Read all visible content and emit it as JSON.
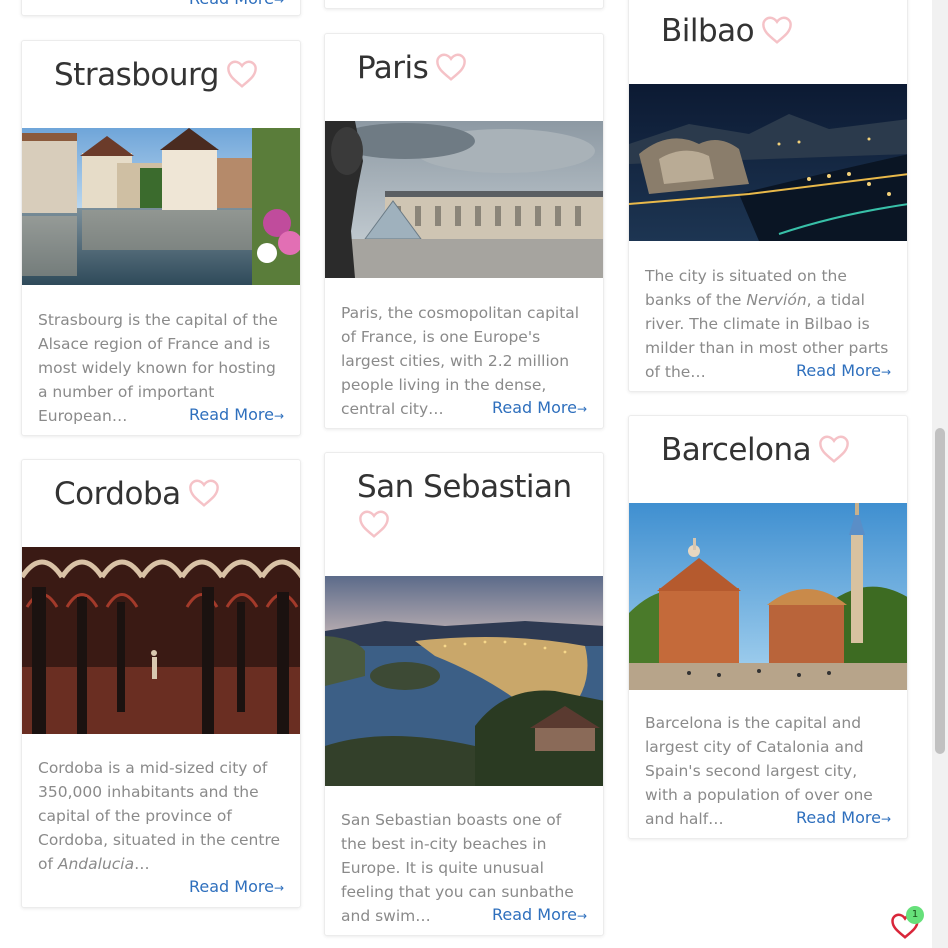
{
  "cards": {
    "strasbourg": {
      "title": "Strasbourg",
      "description": "Strasbourg is the capital of the Alsace region of France and is most widely known for hosting a number of important European…",
      "read_more": "Read More"
    },
    "paris": {
      "title": "Paris",
      "description": "Paris, the cosmopolitan capital of France, is one Europe's largest cities, with 2.2 million people living in the dense, central city…",
      "read_more": "Read More"
    },
    "bilbao": {
      "title": "Bilbao",
      "description_before": "The city is situated on the banks of the ",
      "description_italic": "Nervión",
      "description_after": ", a tidal river. The climate in Bilbao is milder than in most other parts of the…",
      "read_more": "Read More"
    },
    "cordoba": {
      "title": "Cordoba",
      "description_before": "Cordoba is a mid-sized city of 350,000 inhabitants and the capital of the province of Cordoba, situated in the centre of ",
      "description_italic": "Andalucia",
      "description_after": "…",
      "read_more": "Read More"
    },
    "san_sebastian": {
      "title": "San Sebastian",
      "description": "San Sebastian boasts one of the best in-city beaches in Europe. It is quite unusual feeling that you can sunbathe and swim…",
      "read_more": "Read More"
    },
    "barcelona": {
      "title": "Barcelona",
      "description": "Barcelona is the capital and largest city of Catalonia and Spain's second largest city, with a population of over one and half…",
      "read_more": "Read More"
    },
    "top_left_partial": {
      "read_more": "Read More"
    }
  },
  "arrow_glyph": "→",
  "favorites_count": "1",
  "colors": {
    "heart_outline": "#f5c2c7",
    "link": "#2e6fbd",
    "fav_heart": "#d9263a",
    "badge": "#66e07a"
  }
}
